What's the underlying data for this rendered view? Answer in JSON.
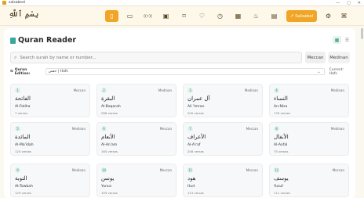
{
  "window": {
    "title": "salsabeel",
    "controls": [
      "—",
      "▢",
      "✕"
    ]
  },
  "logo_text": "بِسْمِ ٱللَّهِ",
  "nav": {
    "items": [
      {
        "name": "quran",
        "icon": "book-icon",
        "glyph": "▯"
      },
      {
        "name": "mushaf",
        "icon": "book-open-icon",
        "glyph": "▭"
      },
      {
        "name": "radio",
        "icon": "broadcast-icon",
        "glyph": "((•))"
      },
      {
        "name": "video",
        "icon": "tv-icon",
        "glyph": "▣"
      },
      {
        "name": "bookmark",
        "icon": "bookmark-icon",
        "glyph": "⌑"
      },
      {
        "name": "favorites",
        "icon": "heart-icon",
        "glyph": "♡"
      },
      {
        "name": "prayer-times",
        "icon": "clock-icon",
        "glyph": "◷"
      },
      {
        "name": "calendar",
        "icon": "calendar-icon",
        "glyph": "▦"
      },
      {
        "name": "tasbih",
        "icon": "flame-icon",
        "glyph": "♨"
      },
      {
        "name": "adhkar",
        "icon": "clipboard-icon",
        "glyph": "▤"
      }
    ],
    "salsabeel_label": "Salsabel",
    "salsabeel_icon": "↗",
    "settings_icon": "⚙",
    "translate_icon": "⌘"
  },
  "page": {
    "title": "Quran Reader",
    "view_grid_icon": "▦",
    "view_list_icon": "☰"
  },
  "search": {
    "placeholder": "Search surah by name or number...",
    "icon": "⌕"
  },
  "script_options": {
    "mecca": "Meccan",
    "medina": "Medinan"
  },
  "edition": {
    "label": "Quran Edition:",
    "selected": "حفص | Hafs",
    "current": "Current: Hafs"
  },
  "surahs": [
    {
      "num": "1",
      "type": "Meccan",
      "arabic": "الفاتحة",
      "en": "Al-Fatiha",
      "verses": "7 verses"
    },
    {
      "num": "2",
      "type": "Medinan",
      "arabic": "البقرة",
      "en": "Al-Baqarah",
      "verses": "286 verses"
    },
    {
      "num": "3",
      "type": "Medinan",
      "arabic": "آل عمران",
      "en": "Ali 'Imran",
      "verses": "200 verses"
    },
    {
      "num": "4",
      "type": "Medinan",
      "arabic": "النساء",
      "en": "An-Nisa",
      "verses": "176 verses"
    },
    {
      "num": "5",
      "type": "Medinan",
      "arabic": "المائدة",
      "en": "Al-Ma'idah",
      "verses": "120 verses"
    },
    {
      "num": "6",
      "type": "Meccan",
      "arabic": "الأنعام",
      "en": "Al-An'am",
      "verses": "165 verses"
    },
    {
      "num": "7",
      "type": "Meccan",
      "arabic": "الأعراف",
      "en": "Al-A'raf",
      "verses": "206 verses"
    },
    {
      "num": "8",
      "type": "Medinan",
      "arabic": "الأنفال",
      "en": "Al-Anfal",
      "verses": "75 verses"
    },
    {
      "num": "9",
      "type": "Medinan",
      "arabic": "التوبة",
      "en": "At-Tawbah",
      "verses": "129 verses"
    },
    {
      "num": "10",
      "type": "Meccan",
      "arabic": "يونس",
      "en": "Yunus",
      "verses": "109 verses"
    },
    {
      "num": "11",
      "type": "Meccan",
      "arabic": "هود",
      "en": "Hud",
      "verses": "123 verses"
    },
    {
      "num": "12",
      "type": "Meccan",
      "arabic": "يوسف",
      "en": "Yusuf",
      "verses": "111 verses"
    }
  ]
}
